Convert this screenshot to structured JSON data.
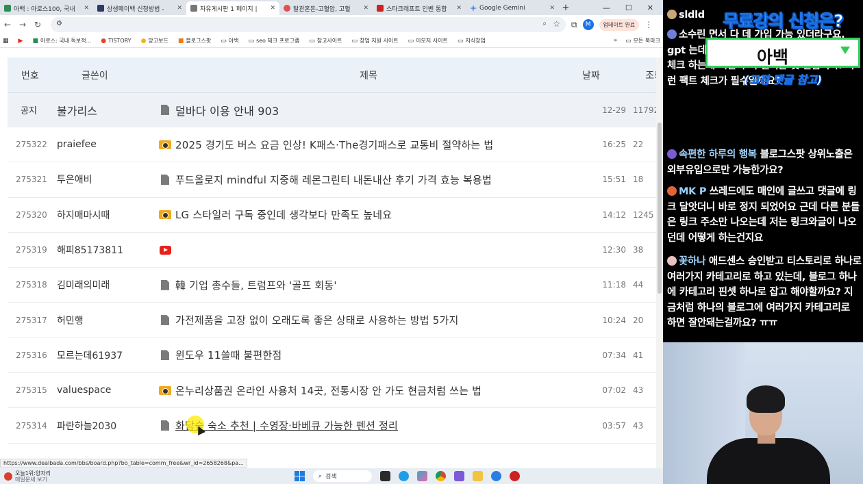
{
  "browser": {
    "tabs": [
      {
        "label": "아백 : 아로스100, 국내",
        "color": "#2e8b57"
      },
      {
        "label": "상생페이백 신청방법 - ",
        "color": "#2b3a67"
      },
      {
        "label": "자유게시판 1 페이지 | ",
        "color": "#777777",
        "active": true
      },
      {
        "label": "탈관혼돈-고혈압, 고혈",
        "color": "#e05050"
      },
      {
        "label": "스타크래프트 인벤 통합",
        "color": "#cc2222"
      },
      {
        "label": "Google Gemini",
        "color": "#5b8def"
      }
    ],
    "update_label": "업데이트 완료",
    "profile_initial": "M",
    "bookmarks": [
      "아로스: 국내 독보적...",
      "TISTORY",
      "망고보드",
      "블로그스팟",
      "아백",
      "seo 체크 프로그램",
      "참고사이트",
      "창업 지원 사이트",
      "이모지 사이트",
      "지식창업"
    ],
    "bookmarks_more": "모든 북마크"
  },
  "board": {
    "headers": {
      "num": "번호",
      "writer": "글쓴이",
      "title": "제목",
      "date": "날짜",
      "views": "조회"
    },
    "notice": {
      "num": "공지",
      "writer": "불가리스",
      "icon": "doc-icon",
      "title": "덜바다 이용 안내    903",
      "date": "12-29",
      "views": "11792"
    },
    "rows": [
      {
        "num": "275322",
        "writer": "praiefee",
        "icon": "camera-icon",
        "title": "2025 경기도 버스 요금 인상! K패스·The경기패스로 교통비 절약하는 법",
        "date": "16:25",
        "views": "22"
      },
      {
        "num": "275321",
        "writer": "투은애비",
        "icon": "doc-icon",
        "title": "푸드올로지 mindful 지중해 레몬그린티 내돈내산 후기 가격 효능 복용법",
        "date": "15:51",
        "views": "18"
      },
      {
        "num": "275320",
        "writer": "하지매마시때",
        "icon": "camera-icon",
        "title": "LG 스타일러 구독 중인데 생각보다 만족도 높네요",
        "date": "14:12",
        "views": "1245"
      },
      {
        "num": "275319",
        "writer": "해피85173811",
        "icon": "youtube-icon",
        "title": "",
        "date": "12:30",
        "views": "38"
      },
      {
        "num": "275318",
        "writer": "김미래의미래",
        "icon": "doc-icon",
        "title": "韓 기업 총수들, 트럼프와 '골프 회동'",
        "date": "11:18",
        "views": "44"
      },
      {
        "num": "275317",
        "writer": "허민행",
        "icon": "doc-icon",
        "title": "가전제품을 고장 없이 오래도록 좋은 상태로 사용하는 방법 5가지",
        "date": "10:24",
        "views": "20"
      },
      {
        "num": "275316",
        "writer": "모르는데61937",
        "icon": "doc-icon",
        "title": "윈도우 11쓸때 불편한점",
        "date": "07:34",
        "views": "41"
      },
      {
        "num": "275315",
        "writer": "valuespace",
        "icon": "camera-icon",
        "title": "온누리상품권 온라인 사용처 14곳, 전통시장 안 가도 현금처럼 쓰는 법",
        "date": "07:02",
        "views": "43"
      },
      {
        "num": "275314",
        "writer": "파란하늘2030",
        "icon": "doc-icon",
        "title": "화담숲 숙소 추천 | 수영장·바베큐 가능한 펜션 정리",
        "date": "03:57",
        "views": "43",
        "hovered": true
      }
    ]
  },
  "status_url": "https://www.dealbada.com/bbs/board.php?bo_table=comm_free&wr_id=2658268&pa...",
  "taskbar": {
    "weather_line1": "오늘1위:양자리",
    "weather_line2": "매일운세 보기",
    "search_label": "검색"
  },
  "chat": {
    "overlay_title": "무료강의 신청은?",
    "overlay_choice": "아백",
    "overlay_note": "(고정 댓글 참고)",
    "messages": [
      {
        "name": "sldld",
        "text": ""
      },
      {
        "name": "소수린",
        "text": "면서 다 데 가입 가능 있더라구요. gpt 는데는 시간이 많이 걸리지 않지만, 팩트 체크 하는게 시간이 더 걸리는 것 같습니다. 이런 팩트 체크가 필수일까요?"
      },
      {
        "name": "속편한 하루의 행복",
        "text": "블로그스팟 상위노출은 외부유입으로만 가능한가요?"
      },
      {
        "name": "MK P",
        "text": "쓰레드에도 매인에 글쓰고 댓글에 링크 달앗더니 바로 정지 되었어요 근데 다른 분들은 링크 주소만 나오는데 저는 링크와글이 나오던데 어떻게 하는건지요"
      },
      {
        "name": "꽃하나",
        "text": "애드센스 승인받고 티스토리로 하나로 여러가지 카테고리로 하고 있는데, 블로그 하나에 카테고리 핀셋 하나로 잡고 해야할까요? 지금처럼 하나의 블로그에 여러가지 카테고리로 하면 잘안돼는걸까요? ㅠㅠ"
      }
    ]
  }
}
